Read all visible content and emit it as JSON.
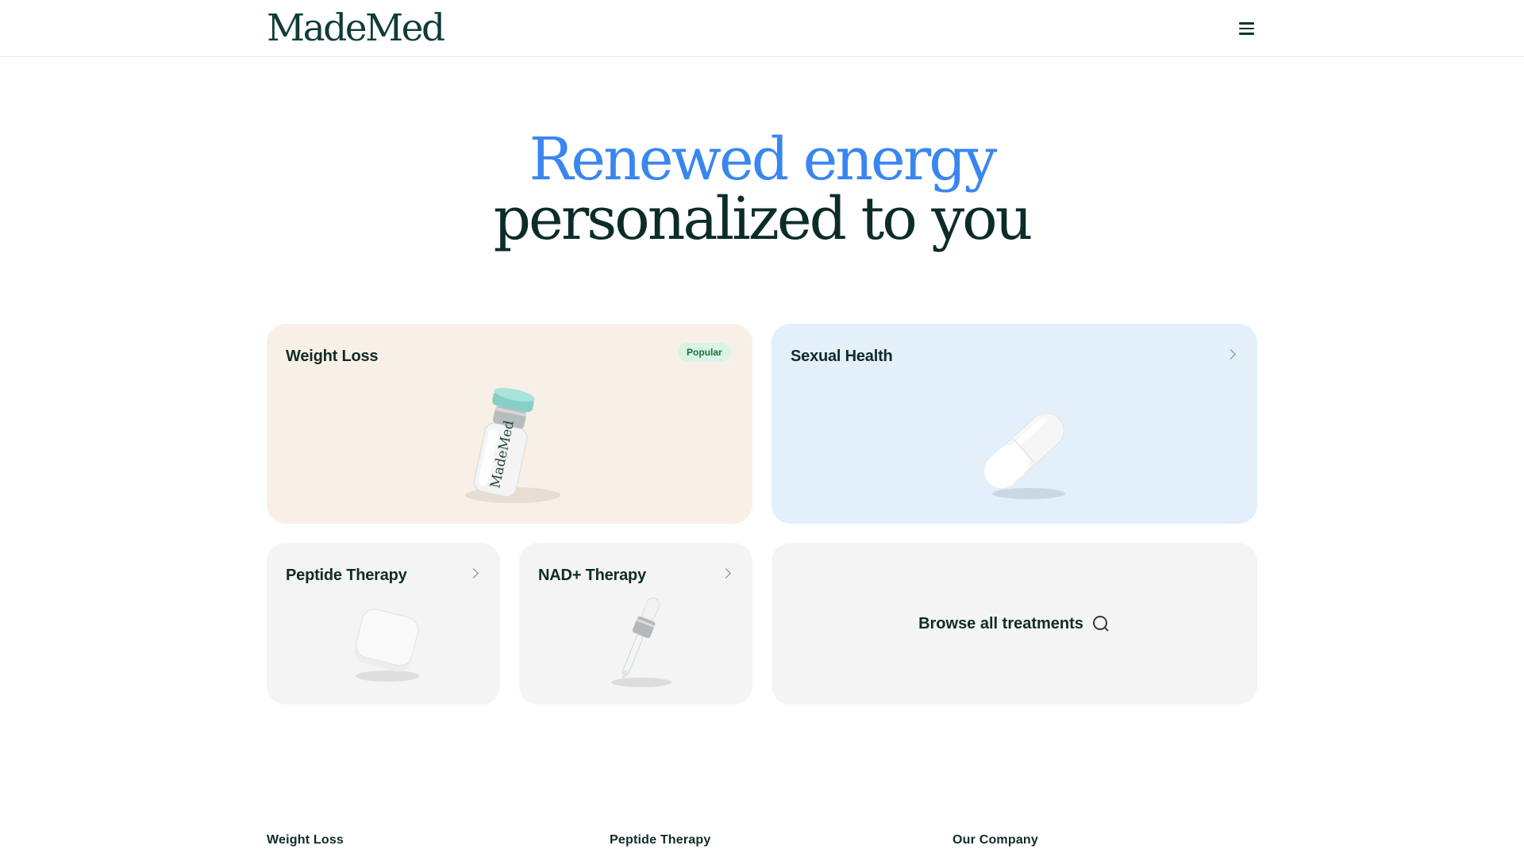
{
  "header": {
    "logo_text": "MadeMed",
    "menu_icon": "hamburger-menu-icon"
  },
  "hero": {
    "line1": "Renewed energy",
    "line2": "personalized to you",
    "accent_color": "#3a86f0",
    "text_color": "#0c2c28"
  },
  "cards": {
    "weight_loss": {
      "title": "Weight Loss",
      "badge": "Popular",
      "image_label": "MadeMed",
      "bg": "#f8f0e6"
    },
    "sexual_health": {
      "title": "Sexual Health",
      "bg": "#e3f0fa"
    },
    "peptide_therapy": {
      "title": "Peptide Therapy",
      "bg": "#f4f4f4"
    },
    "nad_therapy": {
      "title": "NAD+ Therapy",
      "bg": "#f4f4f4"
    },
    "browse": {
      "label": "Browse all treatments"
    }
  },
  "footer": {
    "columns": [
      "Weight Loss",
      "Peptide Therapy",
      "Our Company"
    ]
  }
}
